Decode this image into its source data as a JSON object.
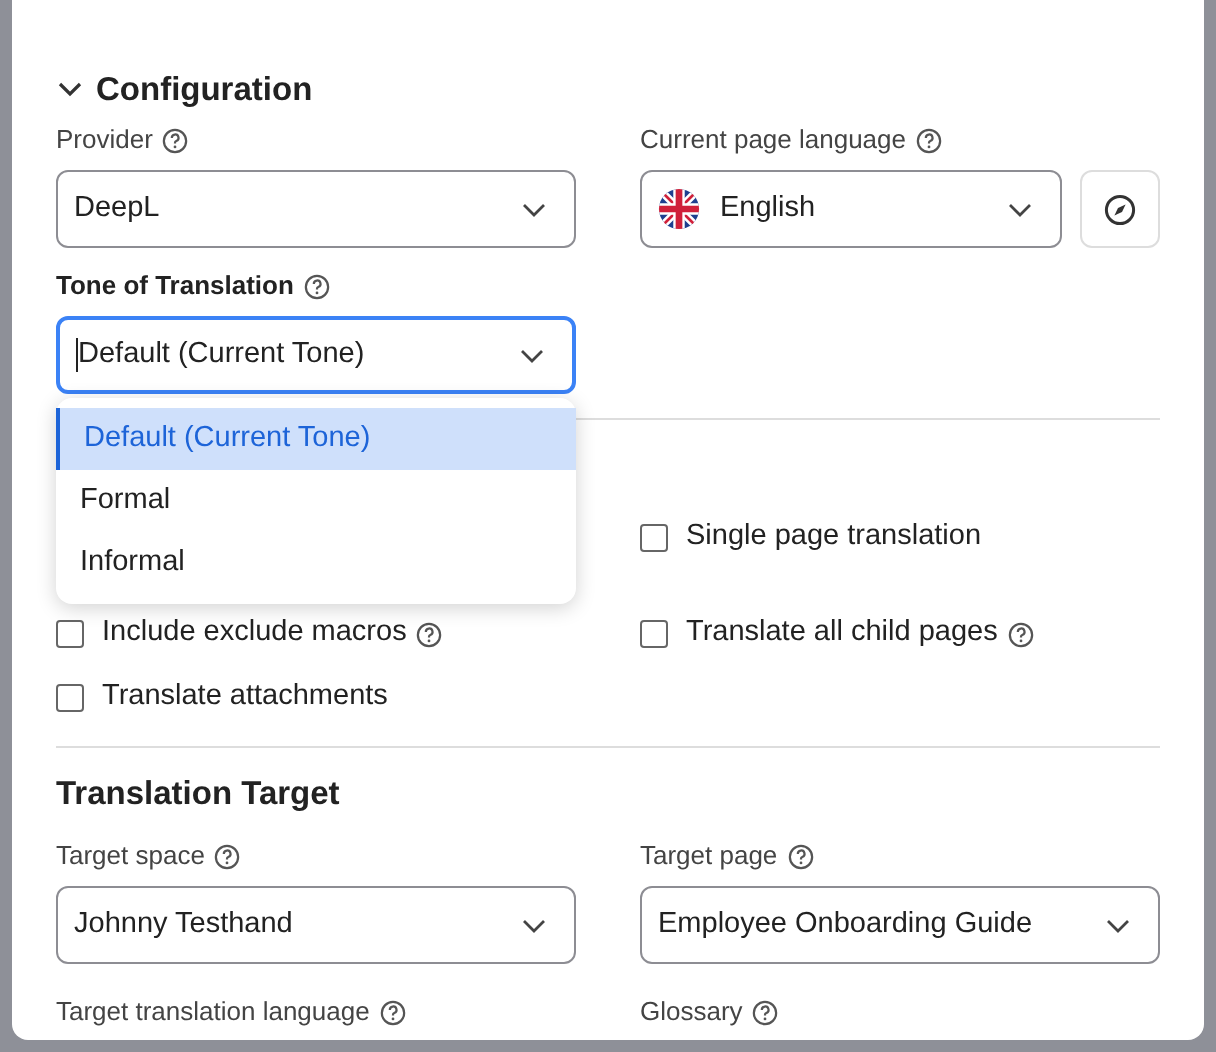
{
  "configuration": {
    "title": "Configuration",
    "expanded": true,
    "provider": {
      "label": "Provider",
      "value": "DeepL"
    },
    "page_language": {
      "label": "Current page language",
      "value": "English"
    },
    "tone": {
      "label": "Tone of Translation",
      "value": "Default (Current Tone)",
      "focused": true
    },
    "tone_menu": [
      {
        "label": "Default (Current Tone)",
        "selected": true
      },
      {
        "label": "Formal",
        "selected": false
      },
      {
        "label": "Informal",
        "selected": false
      }
    ],
    "option_rows": [
      {
        "right": {
          "label": "Single page translation",
          "checked": false,
          "help": false
        }
      },
      {
        "left": {
          "label": "Include exclude macros",
          "checked": false,
          "help": true
        },
        "right": {
          "label": "Translate all child pages",
          "checked": false,
          "help": true
        }
      },
      {
        "left": {
          "label": "Translate attachments",
          "checked": false,
          "help": false
        }
      }
    ]
  },
  "translation_target": {
    "title": "Translation Target",
    "fields": [
      {
        "label": "Target space",
        "value": "Johnny Testhand"
      },
      {
        "label": "Target page",
        "value": "Employee Onboarding Guide"
      },
      {
        "label": "Target translation language"
      },
      {
        "label": "Glossary"
      }
    ]
  }
}
